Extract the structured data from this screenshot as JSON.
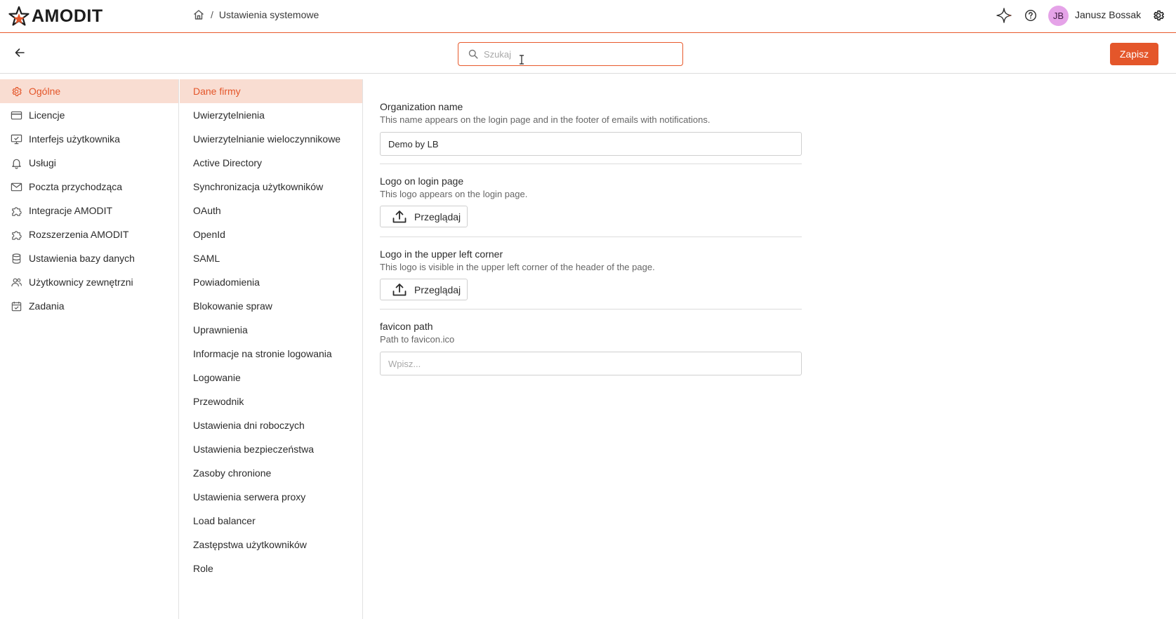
{
  "header": {
    "logo_text": "AMODIT",
    "breadcrumb_separator": "/",
    "breadcrumb_page": "Ustawienia systemowe",
    "user_initials": "JB",
    "user_name": "Janusz Bossak",
    "avatar_color": "#e5a3e8",
    "accent_color": "#e4562a",
    "icons": [
      "home-icon",
      "ai-sparkle-icon",
      "help-icon",
      "settings-gear-icon"
    ]
  },
  "toolbar": {
    "back_icon": "arrow-left-icon",
    "search_placeholder": "Szukaj",
    "search_value": "",
    "save_label": "Zapisz"
  },
  "left_nav": {
    "items": [
      {
        "label": "Ogólne",
        "icon": "gear-icon",
        "active": true
      },
      {
        "label": "Licencje",
        "icon": "card-icon",
        "active": false
      },
      {
        "label": "Interfejs użytkownika",
        "icon": "monitor-icon",
        "active": false
      },
      {
        "label": "Usługi",
        "icon": "bell-icon",
        "active": false
      },
      {
        "label": "Poczta przychodząca",
        "icon": "mail-icon",
        "active": false
      },
      {
        "label": "Integracje AMODIT",
        "icon": "puzzle-icon",
        "active": false
      },
      {
        "label": "Rozszerzenia AMODIT",
        "icon": "puzzle-icon",
        "active": false
      },
      {
        "label": "Ustawienia bazy danych",
        "icon": "database-icon",
        "active": false
      },
      {
        "label": "Użytkownicy zewnętrzni",
        "icon": "users-icon",
        "active": false
      },
      {
        "label": "Zadania",
        "icon": "calendar-check-icon",
        "active": false
      }
    ]
  },
  "mid_nav": {
    "items": [
      {
        "label": "Dane firmy",
        "active": true
      },
      {
        "label": "Uwierzytelnienia",
        "active": false
      },
      {
        "label": "Uwierzytelnianie wieloczynnikowe",
        "active": false
      },
      {
        "label": "Active Directory",
        "active": false
      },
      {
        "label": "Synchronizacja użytkowników",
        "active": false
      },
      {
        "label": "OAuth",
        "active": false
      },
      {
        "label": "OpenId",
        "active": false
      },
      {
        "label": "SAML",
        "active": false
      },
      {
        "label": "Powiadomienia",
        "active": false
      },
      {
        "label": "Blokowanie spraw",
        "active": false
      },
      {
        "label": "Uprawnienia",
        "active": false
      },
      {
        "label": "Informacje na stronie logowania",
        "active": false
      },
      {
        "label": "Logowanie",
        "active": false
      },
      {
        "label": "Przewodnik",
        "active": false
      },
      {
        "label": "Ustawienia dni roboczych",
        "active": false
      },
      {
        "label": "Ustawienia bezpieczeństwa",
        "active": false
      },
      {
        "label": "Zasoby chronione",
        "active": false
      },
      {
        "label": "Ustawienia serwera proxy",
        "active": false
      },
      {
        "label": "Load balancer",
        "active": false
      },
      {
        "label": "Zastępstwa użytkowników",
        "active": false
      },
      {
        "label": "Role",
        "active": false
      }
    ]
  },
  "content": {
    "org_name": {
      "title": "Organization name",
      "desc": "This name appears on the login page and in the footer of emails with notifications.",
      "value": "Demo by LB"
    },
    "logo_login": {
      "title": "Logo on login page",
      "desc": "This logo appears on the login page.",
      "button_label": "Przeglądaj"
    },
    "logo_corner": {
      "title": "Logo in the upper left corner",
      "desc": "This logo is visible in the upper left corner of the header of the page.",
      "button_label": "Przeglądaj"
    },
    "favicon": {
      "title": "favicon path",
      "desc": "Path to favicon.ico",
      "placeholder": "Wpisz..."
    }
  }
}
